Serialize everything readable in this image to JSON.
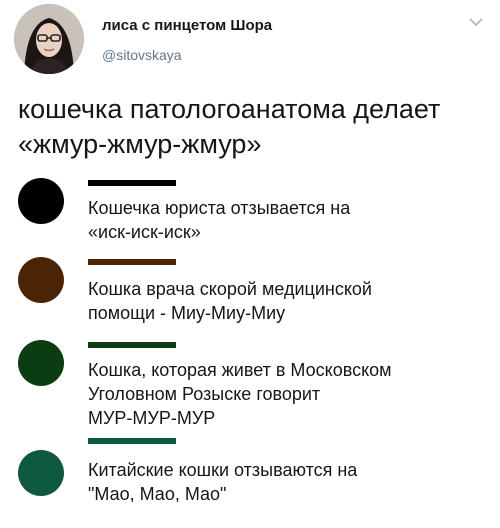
{
  "tweet": {
    "display_name": "лиса с пинцетом Шора",
    "handle": "@sitovskaya",
    "text_lines": [
      "кошечка патологоанатома делает",
      "«жмур-жмур-жмур»"
    ],
    "avatar_icon": "avatar-photo",
    "menu_icon": "chevron-down-icon"
  },
  "items": [
    {
      "color": "#000000",
      "lines": [
        "Кошечка юриста отзывается на",
        "«иск-иск-иск»"
      ]
    },
    {
      "color": "#4a2405",
      "lines": [
        "Кошка врача скорой медицинской",
        "помощи - Миу-Миу-Миу"
      ]
    },
    {
      "color": "#0b3d12",
      "lines": [
        "Кошка, которая живет в Московском",
        "Уголовном Розыске говорит",
        "МУР-МУР-МУР"
      ]
    },
    {
      "color": "#0f5a3e",
      "lines": [
        "Китайские кошки отзываются на",
        "\"Мао, Мао, Мао\""
      ]
    }
  ]
}
